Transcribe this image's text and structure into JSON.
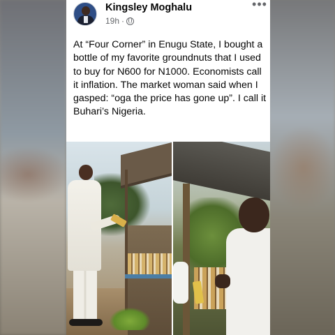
{
  "post": {
    "author": "Kingsley Moghalu",
    "time": "19h",
    "separator": "·",
    "more_label": "•••",
    "text": "At “Four Corner” in Enugu State, I bought a bottle of my favorite groundnuts that I used to buy for N600 for N1000. Economists call it inflation. The market woman said when I gasped: “oga the price has gone up”. I call it Buhari’s Nigeria."
  },
  "icons": {
    "globe": "globe-icon",
    "more": "more-options-icon"
  },
  "colors": {
    "author_text": "#050505",
    "meta_text": "#65676b",
    "card_background": "#ffffff"
  }
}
